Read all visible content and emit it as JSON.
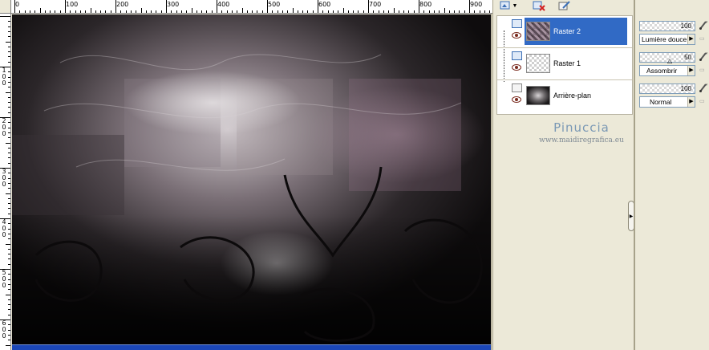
{
  "ruler": {
    "top_labels": [
      "0",
      "100",
      "200",
      "300",
      "400",
      "500",
      "600",
      "700",
      "800",
      "900"
    ],
    "left_labels": [
      "1\n0\n0",
      "2\n0\n0",
      "3\n0\n0",
      "4\n0\n0",
      "5\n0\n0",
      "6\n0\n0"
    ]
  },
  "layers": {
    "items": [
      {
        "name": "Raster 2",
        "selected": true
      },
      {
        "name": "Raster 1",
        "selected": false
      },
      {
        "name": "Arrière-plan",
        "selected": false
      }
    ]
  },
  "watermark": {
    "title": "Pinuccia",
    "url": "www.maidiregrafica.eu"
  },
  "properties": [
    {
      "opacity": "100",
      "blend": "Lumière douce"
    },
    {
      "opacity": "50",
      "blend": "Assombrir"
    },
    {
      "opacity": "100",
      "blend": "Normal"
    }
  ],
  "icons": {
    "toolbar": [
      "new-layer-icon",
      "dropdown-arrow-icon",
      "delete-layer-icon",
      "edit-icon"
    ],
    "eye": "eye-icon",
    "brush": "brush-icon",
    "lock": "lock-icon",
    "collapse": "collapse-arrow-icon"
  },
  "colors": {
    "selection": "#316ac5",
    "panel_bg": "#ece9d8",
    "watermark": "#7b99b5"
  }
}
